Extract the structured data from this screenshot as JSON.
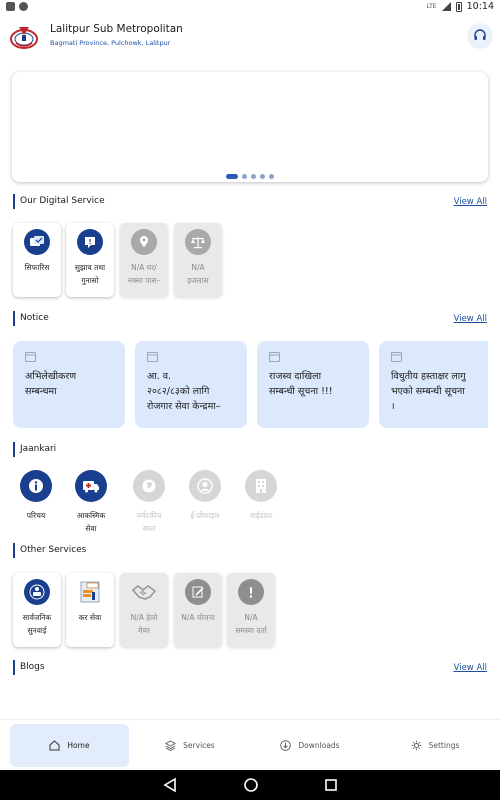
{
  "status_bar": {
    "time": "10:14",
    "network": "LTE"
  },
  "header": {
    "title": "Lalitpur Sub Metropolitan",
    "subtitle": "Bagmati Province, Pulchowk, Lalitpur",
    "help_icon": "headset-icon"
  },
  "banner": {
    "slide_count": 5,
    "active_slide": 1
  },
  "digital_service": {
    "title": "Our Digital Service",
    "view_all": "View All",
    "items": [
      {
        "line1": "सिफारिस",
        "line2": "",
        "icon": "recommendation-icon",
        "enabled": true
      },
      {
        "line1": "सुझाव तथा",
        "line2": "गुनासो",
        "icon": "feedback-icon",
        "enabled": true
      },
      {
        "line1": "N/A घर/",
        "line2": "नक्सा पास–",
        "icon": "map-pin-icon",
        "enabled": false
      },
      {
        "line1": "N/A",
        "line2": "इजलास",
        "icon": "scales-icon",
        "enabled": false
      }
    ]
  },
  "notice": {
    "title": "Notice",
    "view_all": "View All",
    "items": [
      {
        "l1": "अभिलेखीकरण",
        "l2": "सम्बन्धमा",
        "l3": ""
      },
      {
        "l1": "आ. व.",
        "l2": "२०८२/८३को लागि",
        "l3": "रोजगार सेवा केन्द्रमा–"
      },
      {
        "l1": "राजस्व दाखिला",
        "l2": "सम्बन्धी सूचना !!!",
        "l3": ""
      },
      {
        "l1": "विधुतीय हस्ताक्षर लागु",
        "l2": "भएको सम्बन्धी सूचना",
        "l3": "।"
      }
    ]
  },
  "jaankari": {
    "title": "Jaankari",
    "items": [
      {
        "line1": "परिचय",
        "line2": "",
        "icon": "info-icon",
        "enabled": true
      },
      {
        "line1": "आकस्मिक",
        "line2": "सेवा",
        "icon": "ambulance-icon",
        "enabled": true
      },
      {
        "line1": "पर्यटकीय",
        "line2": "स्थल",
        "icon": "globe-icon",
        "enabled": false
      },
      {
        "line1": "ई-प्रोफाइल",
        "line2": "",
        "icon": "profile-icon",
        "enabled": false
      },
      {
        "line1": "वाईडप्रत",
        "line2": "",
        "icon": "building-icon",
        "enabled": false
      }
    ]
  },
  "other_services": {
    "title": "Other Services",
    "items": [
      {
        "line1": "सार्वजनिक",
        "line2": "सुनवाई",
        "icon": "public-hearing-icon",
        "enabled": true
      },
      {
        "line1": "कर सेवा",
        "line2": "",
        "icon": "tax-icon",
        "enabled": true
      },
      {
        "line1": "N/A हेलो",
        "line2": "मेयर",
        "icon": "handshake-icon",
        "enabled": false
      },
      {
        "line1": "N/A योजना",
        "line2": "",
        "icon": "plan-edit-icon",
        "enabled": false
      },
      {
        "line1": "N/A",
        "line2": "समस्या दर्ता",
        "icon": "alert-icon",
        "enabled": false
      }
    ]
  },
  "blogs": {
    "title": "Blogs",
    "view_all": "View All"
  },
  "bottom_nav": {
    "items": [
      {
        "label": "Home",
        "icon": "home-icon",
        "active": true
      },
      {
        "label": "Services",
        "icon": "layers-icon",
        "active": false
      },
      {
        "label": "Downloads",
        "icon": "download-icon",
        "active": false
      },
      {
        "label": "Settings",
        "icon": "gear-icon",
        "active": false
      }
    ]
  },
  "colors": {
    "primary": "#1b3f8f",
    "notice_bg": "#dce8fb",
    "disabled": "#a9a9a9",
    "link": "#1b4fa0"
  }
}
